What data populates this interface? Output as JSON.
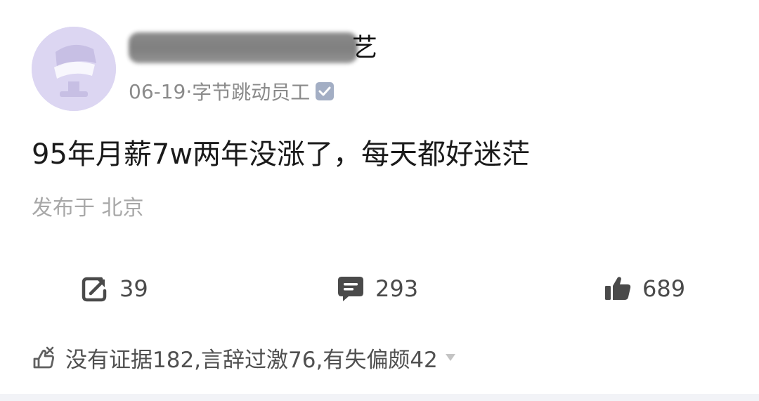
{
  "post": {
    "author_name_visible": "艺",
    "date": "06-19",
    "separator": "·",
    "company_tag": "字节跳动员工",
    "content": "95年月薪7w两年没涨了，每天都好迷茫",
    "location": "发布于 北京"
  },
  "actions": {
    "share_count": "39",
    "comment_count": "293",
    "like_count": "689"
  },
  "feedback": {
    "summary": "没有证据182,言辞过激76,有失偏颇42"
  },
  "icons": {
    "avatar": "cartoon-avatar",
    "verified": "verified-badge-icon",
    "share": "share-icon",
    "comment": "comment-icon",
    "like": "thumbs-up-icon",
    "feedback": "dislike-feedback-icon",
    "expand": "chevron-down-icon"
  },
  "colors": {
    "avatar_bg": "#dcd6f2",
    "meta_text": "#8a8a8a",
    "location_text": "#a8a8a8"
  }
}
